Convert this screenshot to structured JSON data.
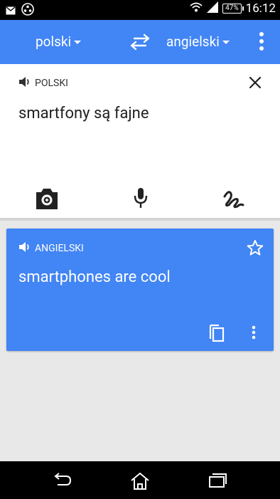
{
  "status": {
    "battery_percent": "47%",
    "time": "16:12"
  },
  "appbar": {
    "source_language": "polski",
    "target_language": "angielski"
  },
  "source": {
    "language_label": "POLSKI",
    "text": "smartfony są fajne"
  },
  "result": {
    "language_label": "ANGIELSKI",
    "text": "smartphones are cool"
  },
  "colors": {
    "accent": "#4285f4",
    "status_bar": "#000000",
    "background": "#e8e8e8"
  },
  "icons": [
    "mail-icon",
    "app-icon",
    "wifi-icon",
    "signal-icon",
    "battery-icon",
    "swap-icon",
    "overflow-menu-icon",
    "speaker-icon",
    "close-icon",
    "camera-icon",
    "microphone-icon",
    "handwriting-icon",
    "star-icon",
    "copy-icon",
    "more-icon",
    "back-icon",
    "home-icon",
    "recent-apps-icon"
  ]
}
